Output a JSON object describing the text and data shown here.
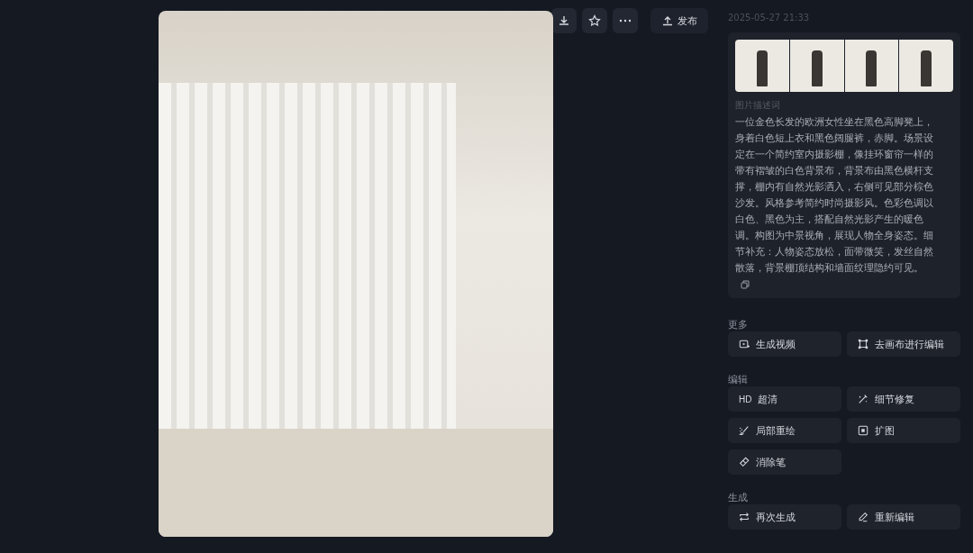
{
  "toolbar": {
    "publish": "发布"
  },
  "timestamp": "2025-05-27 21:33",
  "details": {
    "description_label": "图片描述词",
    "description": "一位金色长发的欧洲女性坐在黑色高脚凳上，身着白色短上衣和黑色阔腿裤，赤脚。场景设定在一个简约室内摄影棚，像挂环窗帘一样的带有褶皱的白色背景布，背景布由黑色横杆支撑，棚内有自然光影洒入，右侧可见部分棕色沙发。风格参考简约时尚摄影风。色彩色调以白色、黑色为主，搭配自然光影产生的暖色调。构图为中景视角，展现人物全身姿态。细节补充：人物姿态放松，面带微笑，发丝自然散落，背景棚顶结构和墙面纹理隐约可见。"
  },
  "sections": [
    {
      "title": "更多",
      "buttons": [
        {
          "kind": "video",
          "label": "生成视频"
        },
        {
          "kind": "canvas",
          "label": "去画布进行编辑"
        }
      ]
    },
    {
      "title": "编辑",
      "buttons": [
        {
          "kind": "badge",
          "badge": "HD",
          "label": "超清"
        },
        {
          "kind": "wand",
          "label": "细节修复"
        },
        {
          "kind": "brush",
          "label": "局部重绘"
        },
        {
          "kind": "expand",
          "label": "扩图"
        },
        {
          "kind": "eraser",
          "label": "消除笔"
        }
      ]
    },
    {
      "title": "生成",
      "buttons": [
        {
          "kind": "repeat",
          "label": "再次生成"
        },
        {
          "kind": "pencil",
          "label": "重新编辑"
        }
      ]
    }
  ]
}
